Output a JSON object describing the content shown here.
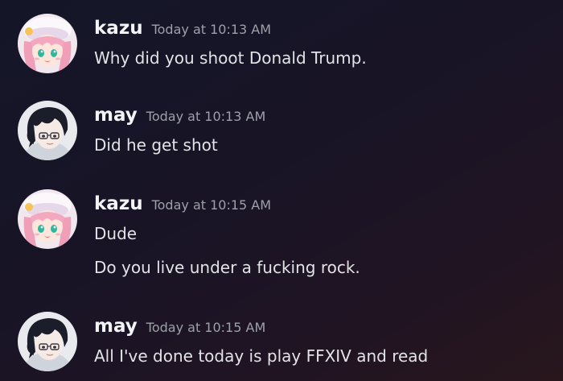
{
  "messages": [
    {
      "username": "kazu",
      "timestamp": "Today at 10:13 AM",
      "avatar": "pink-haired-anime-girl-avatar",
      "lines": [
        "Why did you shoot Donald Trump."
      ]
    },
    {
      "username": "may",
      "timestamp": "Today at 10:13 AM",
      "avatar": "dark-haired-anime-boy-with-glasses-avatar",
      "lines": [
        "Did he get shot"
      ]
    },
    {
      "username": "kazu",
      "timestamp": "Today at 10:15 AM",
      "avatar": "pink-haired-anime-girl-avatar",
      "lines": [
        "Dude",
        "Do you live under a fucking rock."
      ]
    },
    {
      "username": "may",
      "timestamp": "Today at 10:15 AM",
      "avatar": "dark-haired-anime-boy-with-glasses-avatar",
      "lines": [
        "All I've done today is play FFXIV and read"
      ]
    }
  ],
  "colors": {
    "username": "#f2f3f5",
    "timestamp": "#9ea0a8",
    "message_text": "#e2e3e6",
    "background_start": "#141628",
    "background_end": "#28161c"
  }
}
